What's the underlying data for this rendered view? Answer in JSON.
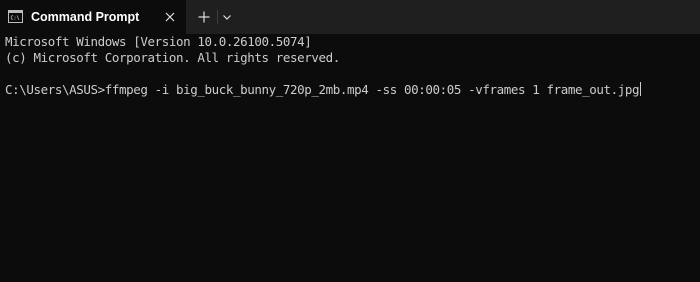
{
  "tab": {
    "title": "Command Prompt",
    "icon": "terminal-icon"
  },
  "toolbar": {
    "new_tab_icon": "plus-icon",
    "dropdown_icon": "chevron-down-icon"
  },
  "terminal": {
    "lines": [
      "Microsoft Windows [Version 10.0.26100.5074]",
      "(c) Microsoft Corporation. All rights reserved.",
      "",
      "C:\\Users\\ASUS>ffmpeg -i big_buck_bunny_720p_2mb.mp4 -ss 00:00:05 -vframes 1 frame_out.jpg"
    ]
  },
  "colors": {
    "background": "#0c0c0c",
    "titlebar": "#1f1f1f",
    "text": "#cccccc",
    "tab_text": "#ffffff"
  }
}
